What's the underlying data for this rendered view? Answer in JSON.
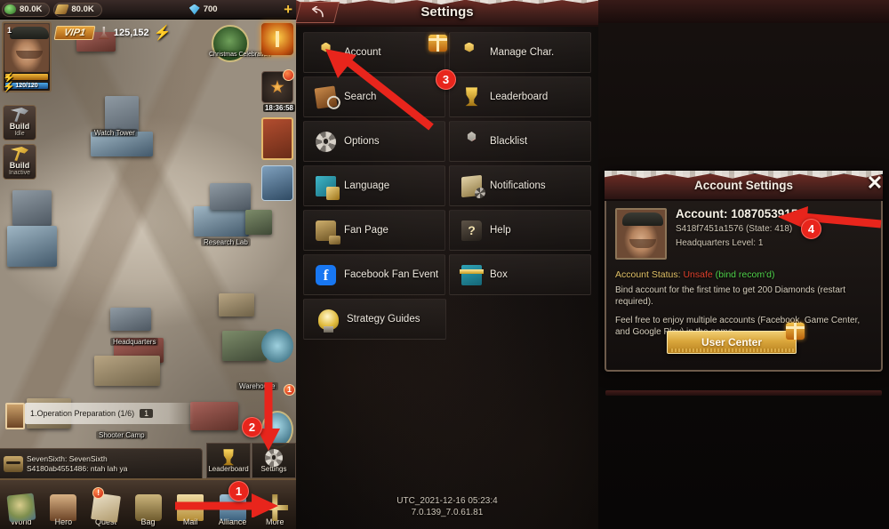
{
  "game": {
    "resources": [
      {
        "icon": "oil-icon",
        "value": "80.0K"
      },
      {
        "icon": "wood-icon",
        "value": "80.0K"
      },
      {
        "icon": "diamond-icon",
        "value": "700"
      }
    ],
    "plus_label": "+",
    "avatar": {
      "level": "1",
      "xp_bar": "",
      "energy_bar": "120/120"
    },
    "vip_label": "VIP1",
    "power_value": "125,152",
    "build_buttons": [
      {
        "title": "Build",
        "state": "Idle"
      },
      {
        "title": "Build",
        "state": "Inactive"
      }
    ],
    "event_icons": [
      {
        "name": "christmas-event-icon",
        "label": "Christmas\nCelebration"
      },
      {
        "name": "gift-event-icon",
        "label": ""
      },
      {
        "name": "medal-event-icon",
        "label": ""
      }
    ],
    "event_timer": "18:36:58",
    "map_labels": [
      "Watch Tower",
      "Research Lab",
      "Headquarters",
      "Warehouse",
      "Shooter Camp"
    ],
    "quest": {
      "text": "1.Operation Preparation (1/6)",
      "count": "1"
    },
    "chat": {
      "line1": "SevenSixth: SevenSixth",
      "line2": "S4180ab4551486: ntah lah ya"
    },
    "corner_buttons": [
      {
        "name": "leaderboard-button",
        "label": "Leaderboard"
      },
      {
        "name": "settings-button",
        "label": "Settings"
      }
    ],
    "nav": [
      {
        "name": "world",
        "label": "World"
      },
      {
        "name": "hero",
        "label": "Hero"
      },
      {
        "name": "quest",
        "label": "Quest"
      },
      {
        "name": "bag",
        "label": "Bag"
      },
      {
        "name": "mail",
        "label": "Mail"
      },
      {
        "name": "alliance",
        "label": "Alliance"
      },
      {
        "name": "more",
        "label": "More"
      }
    ]
  },
  "settings": {
    "title": "Settings",
    "back_icon": "back-arrow-icon",
    "items": [
      {
        "label": "Account",
        "icon": "account-icon",
        "badge": "gift"
      },
      {
        "label": "Manage Char.",
        "icon": "manage-char-icon",
        "badge": ""
      },
      {
        "label": "Search",
        "icon": "search-icon",
        "badge": ""
      },
      {
        "label": "Leaderboard",
        "icon": "trophy-icon",
        "badge": ""
      },
      {
        "label": "Options",
        "icon": "gear-icon",
        "badge": ""
      },
      {
        "label": "Blacklist",
        "icon": "blacklist-icon",
        "badge": ""
      },
      {
        "label": "Language",
        "icon": "language-icon",
        "badge": ""
      },
      {
        "label": "Notifications",
        "icon": "notification-icon",
        "badge": ""
      },
      {
        "label": "Fan Page",
        "icon": "fan-page-icon",
        "badge": ""
      },
      {
        "label": "Help",
        "icon": "help-icon",
        "badge": ""
      },
      {
        "label": "Facebook Fan Event",
        "icon": "facebook-icon",
        "badge": ""
      },
      {
        "label": "Box",
        "icon": "box-icon",
        "badge": ""
      },
      {
        "label": "Strategy Guides",
        "icon": "lightbulb-icon",
        "badge": ""
      }
    ],
    "version_line1": "UTC_2021-12-16 05:23:4",
    "version_line2": "7.0.139_7.0.61.81"
  },
  "account_dialog": {
    "title": "Account Settings",
    "close_icon": "close-icon",
    "account_label": "Account: 1087053915",
    "server_line": "S418f7451a1576 (State: 418)",
    "hq_line": "Headquarters Level: 1",
    "status_label": "Account Status:",
    "status_value": "Unsafe",
    "status_recommend": "(bind recom'd)",
    "bind_note": "Bind account for the first time to get 200 Diamonds (restart required).",
    "multi_note": "Feel free to enjoy multiple accounts (Facebook, Game Center, and Google Play) in the game.",
    "user_center_label": "User Center"
  },
  "annotations": [
    {
      "number": "1",
      "target": "more-nav-button"
    },
    {
      "number": "2",
      "target": "settings-button"
    },
    {
      "number": "3",
      "target": "account-menu-item"
    },
    {
      "number": "4",
      "target": "account-id-text"
    }
  ],
  "colors": {
    "accent_red": "#e8251c",
    "gold": "#d9a63c",
    "status_unsafe": "#e0402c",
    "status_recommend": "#4fd24a",
    "header_red": "#6b2b24"
  }
}
